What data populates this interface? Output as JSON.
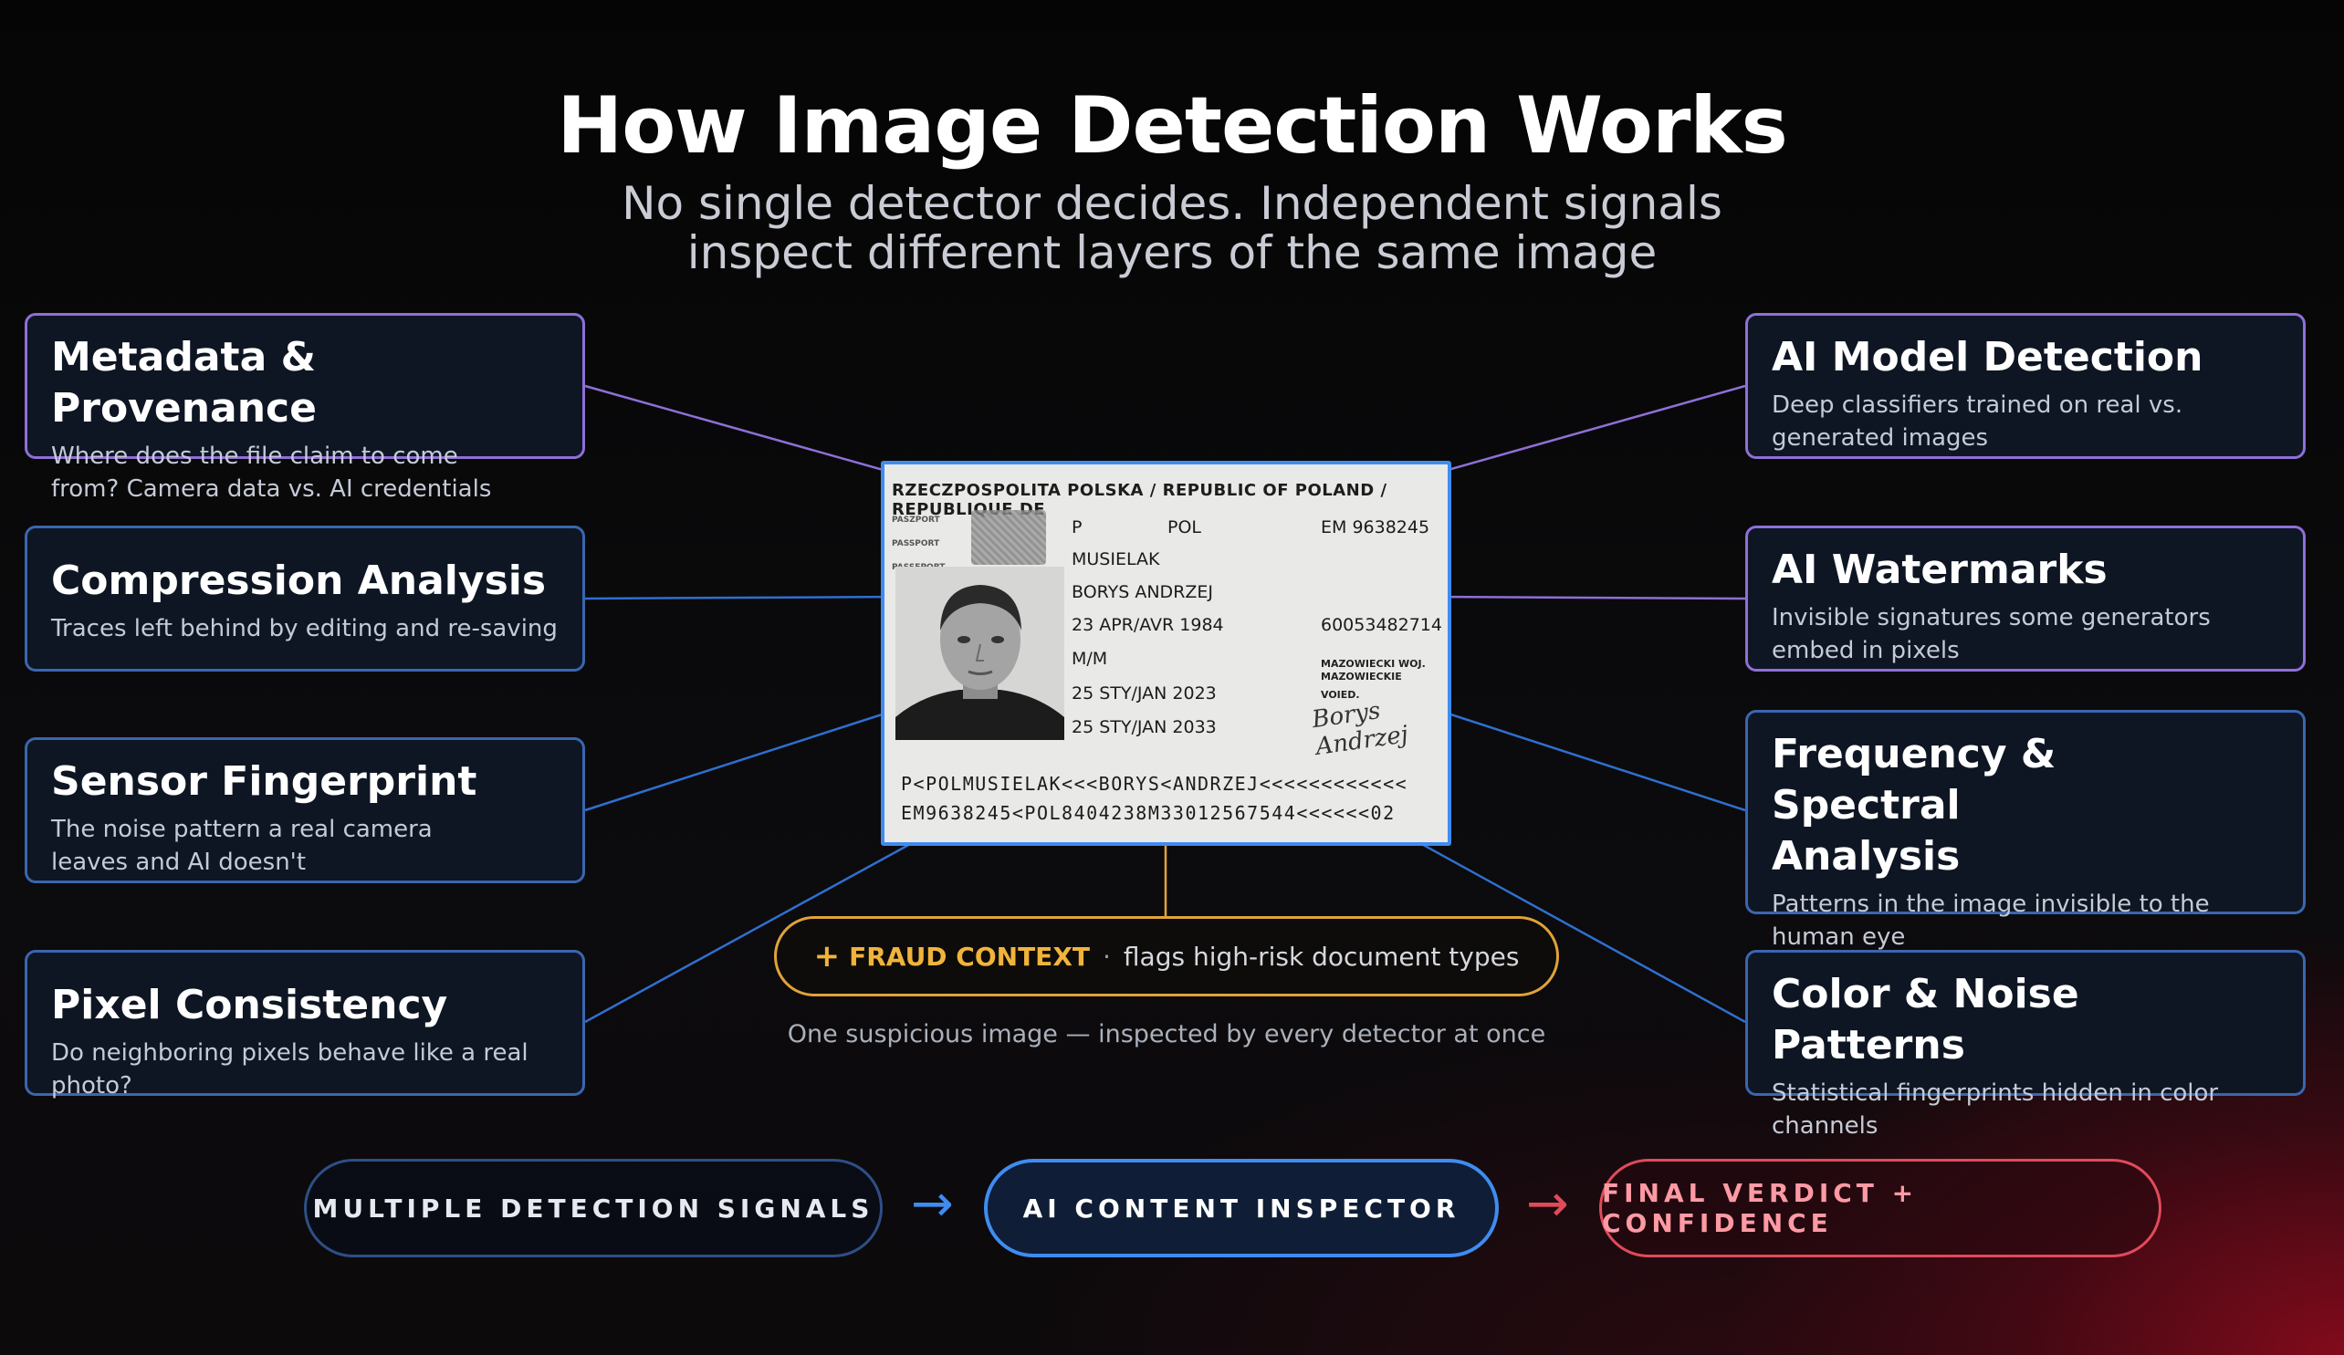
{
  "title": "How Image Detection Works",
  "subtitle": "No single detector decides. Independent signals inspect different layers of the same image",
  "left_cards": [
    {
      "title": "Metadata & Provenance",
      "desc": "Where does the file claim to come from? Camera data vs. AI credentials"
    },
    {
      "title": "Compression Analysis",
      "desc": "Traces left behind by editing and re-saving"
    },
    {
      "title": "Sensor Fingerprint",
      "desc": "The noise pattern a real camera leaves and AI doesn't"
    },
    {
      "title": "Pixel Consistency",
      "desc": "Do neighboring pixels behave like a real photo?"
    }
  ],
  "right_cards": [
    {
      "title": "AI Model Detection",
      "desc": "Deep classifiers trained on real vs. generated images"
    },
    {
      "title": "AI Watermarks",
      "desc": "Invisible signatures some generators embed in pixels"
    },
    {
      "title": "Frequency & Spectral Analysis",
      "desc": "Patterns in the image invisible to the human eye"
    },
    {
      "title": "Color & Noise Patterns",
      "desc": "Statistical fingerprints hidden in color channels"
    }
  ],
  "document": {
    "header": "RZECZPOSPOLITA POLSKA / REPUBLIC OF POLAND / REPUBLIQUE DE",
    "side_labels": [
      "PASZPORT",
      "PASSPORT",
      "PASSEPORT"
    ],
    "type": "P",
    "code": "POL",
    "passport_no": "EM 9638245",
    "surname": "MUSIELAK",
    "given_names": "BORYS ANDRZEJ",
    "dob": "23 APR/AVR 1984",
    "personal_no": "60053482714",
    "sex": "M/M",
    "authority": "MAZOWIECKI WOJ. MAZOWIECKIE",
    "void": "VOIED.",
    "issue_date": "25 STY/JAN 2023",
    "expiry_date": "25 STY/JAN 2033",
    "signature": "Borys Andrzej",
    "mrz_line1": "P<POLMUSIELAK<<<BORYS<ANDRZEJ<<<<<<<<<<<<",
    "mrz_line2": "EM9638245<POL8404238M33012567544<<<<<<02"
  },
  "fraud": {
    "label": "FRAUD CONTEXT",
    "separator": "·",
    "text": "flags high-risk document types"
  },
  "caption": "One suspicious image — inspected by every detector at once",
  "flow": {
    "step1": "MULTIPLE DETECTION SIGNALS",
    "step2": "AI CONTENT INSPECTOR",
    "step3": "FINAL VERDICT + CONFIDENCE",
    "arrow": "→"
  },
  "colors": {
    "purple": "#8f6fd6",
    "blue": "#3f8cf0",
    "amber": "#f0b43c",
    "red": "#e04b5a"
  }
}
